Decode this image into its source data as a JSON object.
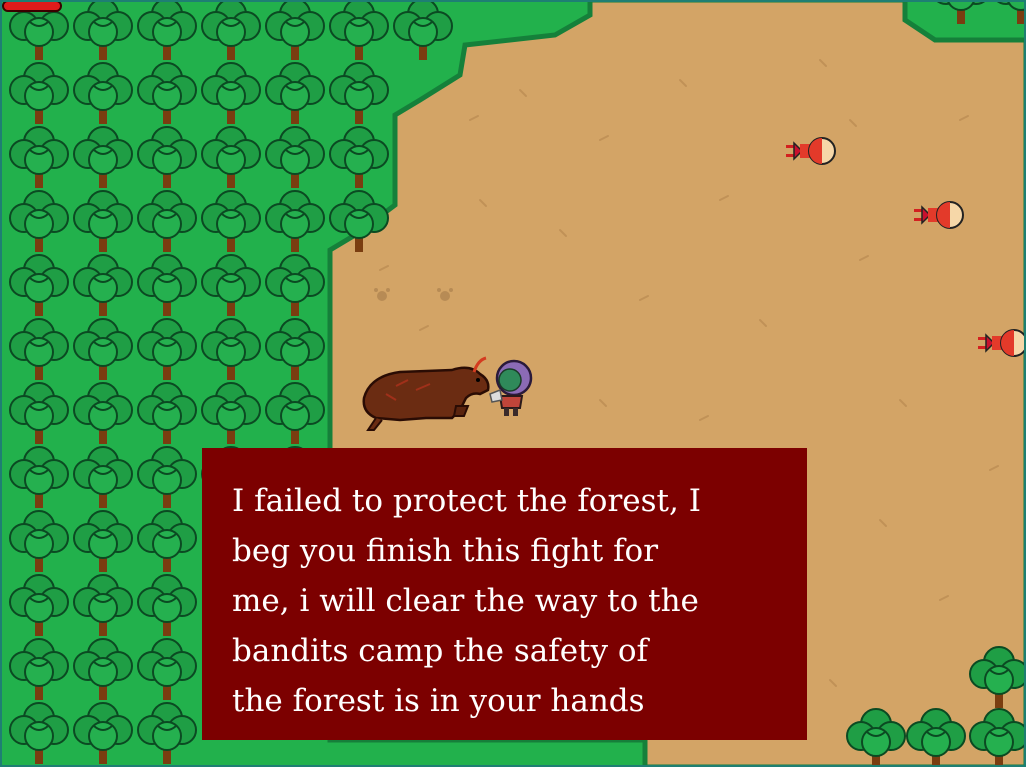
{
  "player": {
    "health_fraction": 1.0
  },
  "dialog": {
    "text": "I failed to protect the forest, I beg you finish this fight for me, i will clear the way to the bandits camp the safety of the forest is in your hands"
  },
  "scene": {
    "enemies": [
      {
        "name": "bandit"
      },
      {
        "name": "bandit"
      },
      {
        "name": "bandit"
      }
    ],
    "npc": "wounded-bull",
    "player_character": "hooded-hero"
  },
  "colors": {
    "grass": "#22b14c",
    "dirt": "#d3a466",
    "tree_leaf": "#1f9e45",
    "dialog_bg": "#7c0000",
    "health": "#e01b1b"
  }
}
